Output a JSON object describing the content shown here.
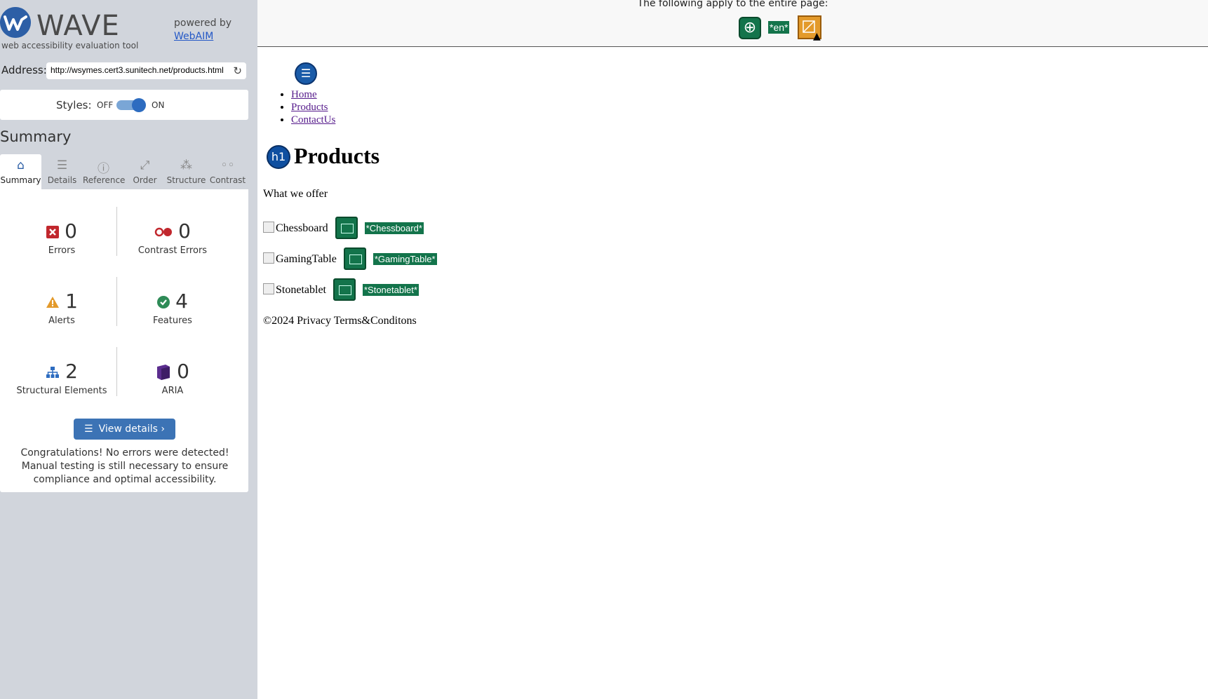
{
  "sidebar": {
    "logo": {
      "name": "WAVE",
      "tagline": "web accessibility evaluation tool"
    },
    "powered_by": {
      "text": "powered by",
      "link": "WebAIM"
    },
    "address": {
      "label": "Address:",
      "value": "http://wsymes.cert3.sunitech.net/products.html"
    },
    "styles": {
      "label": "Styles:",
      "off": "OFF",
      "on": "ON",
      "state": "on"
    },
    "summary_title": "Summary",
    "tabs": [
      {
        "label": "Summary",
        "icon": "home-icon",
        "active": true
      },
      {
        "label": "Details",
        "icon": "list-icon"
      },
      {
        "label": "Reference",
        "icon": "info-icon"
      },
      {
        "label": "Order",
        "icon": "order-icon"
      },
      {
        "label": "Structure",
        "icon": "structure-icon"
      },
      {
        "label": "Contrast",
        "icon": "contrast-icon"
      }
    ],
    "stats": {
      "errors": {
        "count": "0",
        "label": "Errors",
        "color": "#c1272d"
      },
      "contrast_errors": {
        "count": "0",
        "label": "Contrast Errors",
        "color": "#c1272d"
      },
      "alerts": {
        "count": "1",
        "label": "Alerts",
        "color": "#e39a2b"
      },
      "features": {
        "count": "4",
        "label": "Features",
        "color": "#2e8b57"
      },
      "structural": {
        "count": "2",
        "label": "Structural Elements",
        "color": "#2d6cc0"
      },
      "aria": {
        "count": "0",
        "label": "ARIA",
        "color": "#5b2d8e"
      }
    },
    "view_details": "View details ›",
    "congrats": "Congratulations! No errors were detected! Manual testing is still necessary to ensure compliance and optimal accessibility."
  },
  "main": {
    "topbar_text": "The following apply to the entire page:",
    "lang_badge": "*en*",
    "nav": [
      "Home",
      "Products",
      "ContactUs"
    ],
    "heading_badge": "h1",
    "heading": "Products",
    "tagline": "What we offer",
    "products": [
      {
        "alt": "Chessboard",
        "badge": "*Chessboard*"
      },
      {
        "alt": "GamingTable",
        "badge": "*GamingTable*"
      },
      {
        "alt": "Stonetablet",
        "badge": "*Stonetablet*"
      }
    ],
    "footer": "©2024 Privacy Terms&Conditons"
  }
}
